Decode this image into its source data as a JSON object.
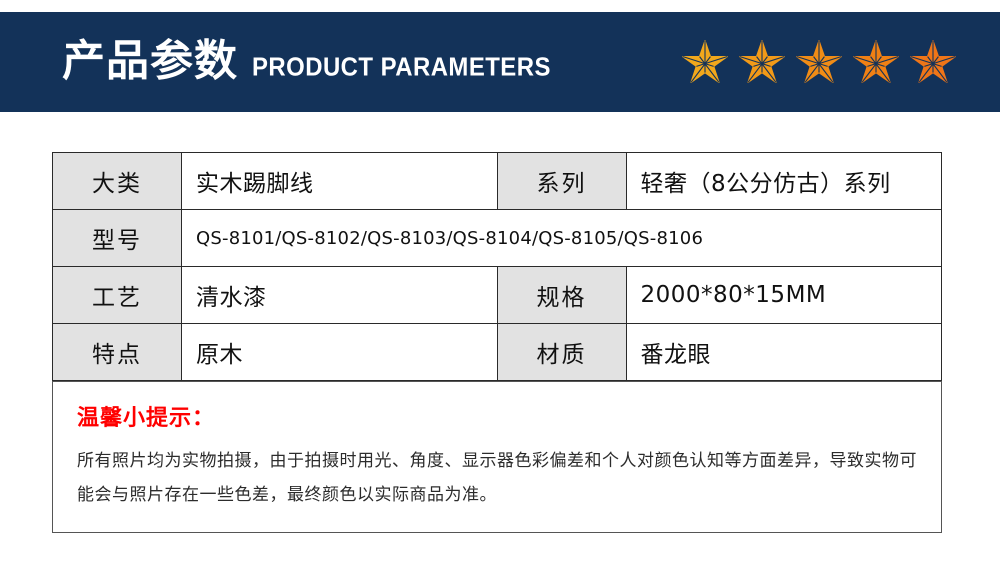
{
  "header": {
    "title_cn": "产品参数",
    "title_en": "PRODUCT PARAMETERS",
    "background_color": "#133259",
    "text_color": "#ffffff",
    "stars": [
      {
        "name": "rating-star-1",
        "color": "#F2A81C"
      },
      {
        "name": "rating-star-2",
        "color": "#F29A18"
      },
      {
        "name": "rating-star-3",
        "color": "#F08C16"
      },
      {
        "name": "rating-star-4",
        "color": "#F08014"
      },
      {
        "name": "rating-star-5",
        "color": "#EF7518"
      }
    ]
  },
  "spec_table": {
    "label_bg_color": "#e2e2e2",
    "border_color": "#2a2a2a",
    "rows": [
      {
        "label_left": "大类",
        "value_left": "实木踢脚线",
        "label_right": "系列",
        "value_right": "轻奢（8公分仿古）系列"
      },
      {
        "label_left": "型号",
        "value_left": "QS-8101/QS-8102/QS-8103/QS-8104/QS-8105/QS-8106",
        "label_right": "",
        "value_right": ""
      },
      {
        "label_left": "工艺",
        "value_left": "清水漆",
        "label_right": "规格",
        "value_right": "2000*80*15MM"
      },
      {
        "label_left": "特点",
        "value_left": "原木",
        "label_right": "材质",
        "value_right": "番龙眼"
      }
    ]
  },
  "notice": {
    "title": "温馨小提示：",
    "title_color": "#ff0000",
    "body": "所有照片均为实物拍摄，由于拍摄时用光、角度、显示器色彩偏差和个人对颜色认知等方面差异，导致实物可能会与照片存在一些色差，最终颜色以实际商品为准。"
  }
}
